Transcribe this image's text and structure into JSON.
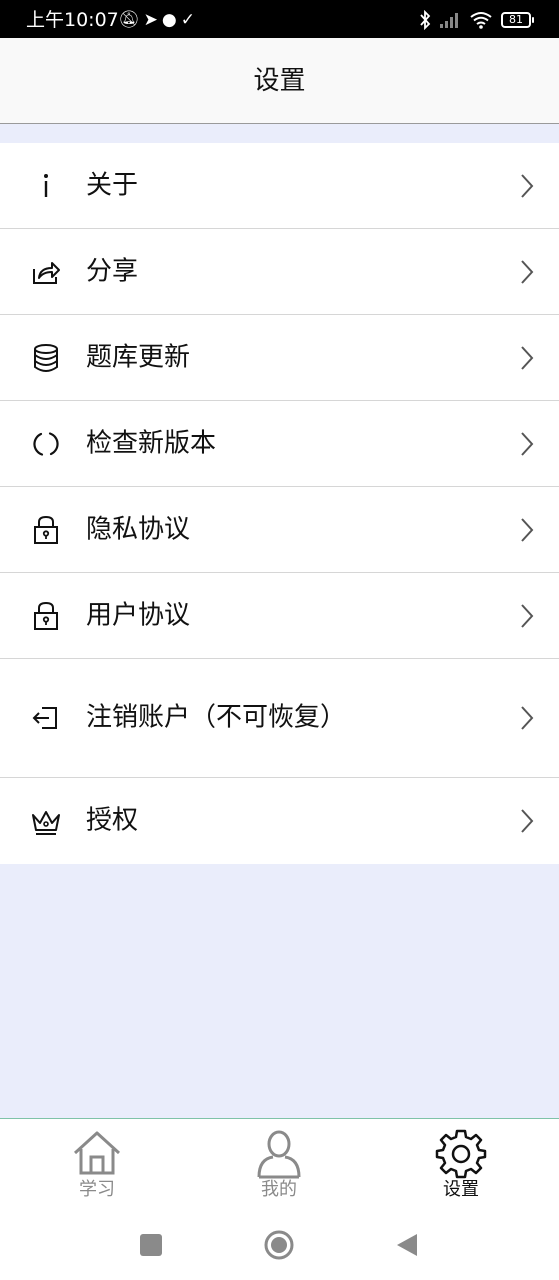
{
  "status_bar": {
    "time": "上午10:07",
    "left_icons": [
      "mute-icon",
      "telegram-icon",
      "chat-bubble-icon",
      "check-icon"
    ],
    "right_icons": [
      "bluetooth-icon",
      "signal-icon",
      "wifi-icon"
    ],
    "battery": "81"
  },
  "header": {
    "title": "设置"
  },
  "menu": {
    "items": [
      {
        "label": "关于",
        "icon": "info-icon"
      },
      {
        "label": "分享",
        "icon": "share-icon"
      },
      {
        "label": "题库更新",
        "icon": "database-icon"
      },
      {
        "label": "检查新版本",
        "icon": "refresh-icon"
      },
      {
        "label": "隐私协议",
        "icon": "lock-icon"
      },
      {
        "label": "用户协议",
        "icon": "lock-icon"
      },
      {
        "label": "注销账户（不可恢复）",
        "icon": "logout-icon"
      },
      {
        "label": "授权",
        "icon": "crown-icon"
      }
    ]
  },
  "tabs": [
    {
      "label": "学习",
      "icon": "home-icon",
      "active": false
    },
    {
      "label": "我的",
      "icon": "person-icon",
      "active": false
    },
    {
      "label": "设置",
      "icon": "gear-icon",
      "active": true
    }
  ],
  "colors": {
    "background": "#eaedfb",
    "tab_inactive": "#8a8a8a",
    "tab_active": "#111111",
    "tabbar_border": "#7fc3a8"
  }
}
